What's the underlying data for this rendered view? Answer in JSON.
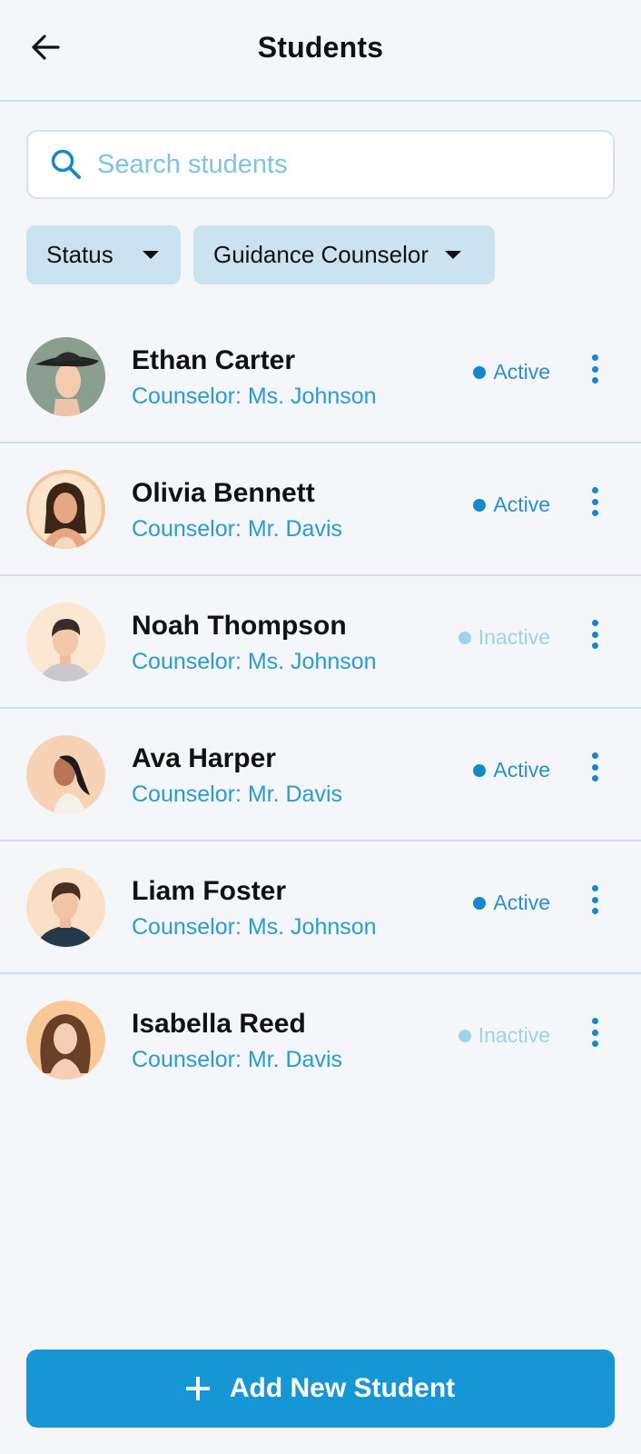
{
  "header": {
    "title": "Students",
    "back_icon": "arrow-left-icon"
  },
  "search": {
    "placeholder": "Search students",
    "value": "",
    "icon": "search-icon"
  },
  "filters": {
    "status_label": "Status",
    "counselor_label": "Guidance Counselor"
  },
  "colors": {
    "accent": "#1796d6",
    "active": "#1787cc",
    "inactive": "#9fd1ec",
    "divider": "#c9e2f2"
  },
  "students": [
    {
      "name": "Ethan Carter",
      "counselor": "Counselor: Ms. Johnson",
      "status": "Active"
    },
    {
      "name": "Olivia Bennett",
      "counselor": "Counselor: Mr. Davis",
      "status": "Active"
    },
    {
      "name": "Noah Thompson",
      "counselor": "Counselor: Ms. Johnson",
      "status": "Inactive"
    },
    {
      "name": "Ava Harper",
      "counselor": "Counselor: Mr. Davis",
      "status": "Active"
    },
    {
      "name": "Liam Foster",
      "counselor": "Counselor: Ms. Johnson",
      "status": "Active"
    },
    {
      "name": "Isabella Reed",
      "counselor": "Counselor: Mr. Davis",
      "status": "Inactive"
    }
  ],
  "add_button": {
    "label": "Add New Student",
    "icon": "plus-icon"
  }
}
